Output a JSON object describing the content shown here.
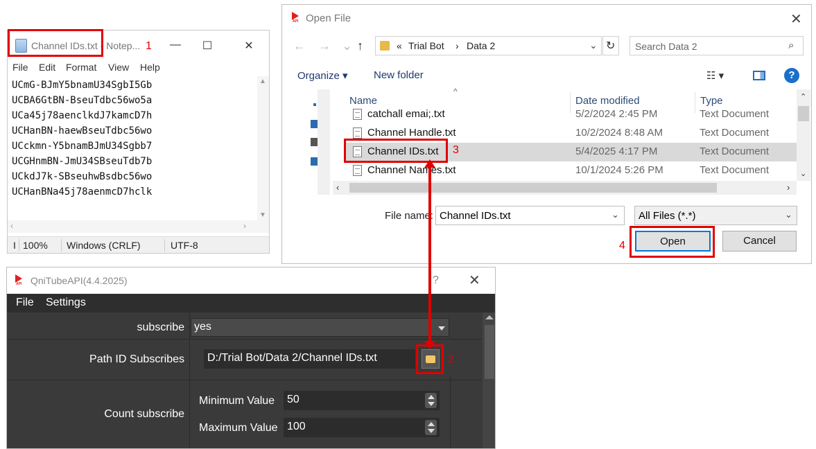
{
  "notepad": {
    "title": "Channel IDs.txt - Notep...",
    "window_controls": {
      "minimize": "—",
      "maximize": "☐",
      "close": "✕"
    },
    "menu": [
      "File",
      "Edit",
      "Format",
      "View",
      "Help"
    ],
    "lines": [
      "UCmG-BJmY5bnamU34SgbI5Gb",
      "UCBA6GtBN-BseuTdbc56wo5a",
      "UCa45j78aenclkdJ7kamcD7h",
      "UCHanBN-haewBseuTdbc56wo",
      "UCckmn-Y5bnamBJmU34Sgbb7",
      "UCGHnmBN-JmU34SBseuTdb7b",
      "UCkdJ7k-SBseuhwBsdbc56wo",
      "UCHanBNa45j78aenmcD7hclk"
    ],
    "status": {
      "col": "I",
      "zoom": "100%",
      "line_ending": "Windows (CRLF)",
      "encoding": "UTF-8"
    }
  },
  "open_file": {
    "title": "Open File",
    "icon_label": "API",
    "close": "✕",
    "breadcrumb": {
      "overflow": "«",
      "parts": [
        "Trial Bot",
        "Data 2"
      ],
      "sep": "›"
    },
    "search_placeholder": "Search Data 2",
    "toolbar": {
      "organize": "Organize ▾",
      "new_folder": "New folder",
      "views": "☷ ▾",
      "help": "?"
    },
    "columns": {
      "name": "Name",
      "date": "Date modified",
      "type": "Type"
    },
    "files": [
      {
        "name": "catchall emai;.txt",
        "date": "5/2/2024 2:45 PM",
        "type": "Text Document"
      },
      {
        "name": "Channel Handle.txt",
        "date": "10/2/2024 8:48 AM",
        "type": "Text Document"
      },
      {
        "name": "Channel IDs.txt",
        "date": "5/4/2025 4:17 PM",
        "type": "Text Document",
        "selected": true
      },
      {
        "name": "Channel Names.txt",
        "date": "10/1/2024 5:26 PM",
        "type": "Text Document"
      }
    ],
    "file_name_label": "File name:",
    "file_name_value": "Channel IDs.txt",
    "file_type_value": "All Files (*.*)",
    "open_button": "Open",
    "cancel_button": "Cancel"
  },
  "qni": {
    "title": "QniTubeAPI(4.4.2025)",
    "help": "?",
    "close": "✕",
    "menu": [
      "File",
      "Settings"
    ],
    "subscribe_label": "subscribe",
    "subscribe_value": "yes",
    "path_label": "Path ID Subscribes",
    "path_value": "D:/Trial Bot/Data 2/Channel IDs.txt",
    "count_label": "Count subscribe",
    "min_label": "Minimum Value",
    "min_value": "50",
    "max_label": "Maximum Value",
    "max_value": "100"
  },
  "annotations": {
    "steps": [
      "1",
      "2",
      "3",
      "4"
    ],
    "highlight_color": "#e00000"
  }
}
